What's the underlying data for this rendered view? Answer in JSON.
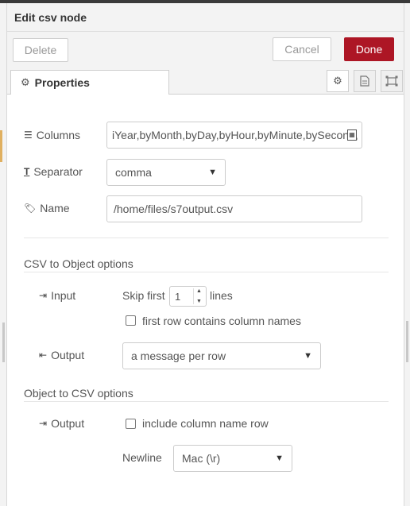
{
  "window": {
    "title": "Edit csv node"
  },
  "toolbar": {
    "delete_label": "Delete",
    "cancel_label": "Cancel",
    "done_label": "Done"
  },
  "tabs": {
    "properties_label": "Properties"
  },
  "form": {
    "columns_label": "Columns",
    "columns_value": "iYear,byMonth,byDay,byHour,byMinute,bySecond,",
    "separator_label": "Separator",
    "separator_value": "comma",
    "name_label": "Name",
    "name_value": "/home/files/s7output.csv"
  },
  "csv_to_object": {
    "section_title": "CSV to Object options",
    "input_label": "Input",
    "skip_first_label": "Skip first",
    "skip_first_value": "1",
    "lines_label": "lines",
    "first_row_label": "first row contains column names",
    "output_label": "Output",
    "output_value": "a message per row"
  },
  "object_to_csv": {
    "section_title": "Object to CSV options",
    "output_label": "Output",
    "include_header_label": "include column name row",
    "newline_label": "Newline",
    "newline_value": "Mac (\\r)"
  },
  "colors": {
    "done_button": "#ad1625",
    "panel_bg": "#f3f3f3"
  }
}
